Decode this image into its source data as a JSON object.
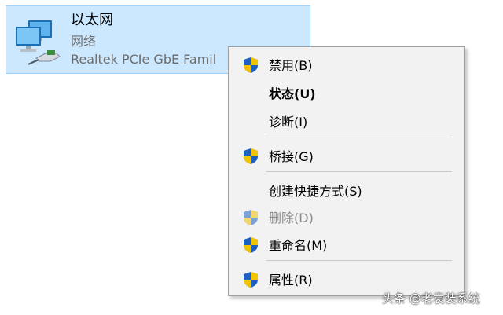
{
  "adapter": {
    "name": "以太网",
    "status": "网络",
    "device": "Realtek PCIe GbE Famil",
    "icon": "network-adapter-icon"
  },
  "context_menu": {
    "items": [
      {
        "label": "禁用(B)",
        "icon": "uac-shield-icon",
        "bold": false,
        "disabled": false
      },
      {
        "label": "状态(U)",
        "icon": "",
        "bold": true,
        "disabled": false
      },
      {
        "label": "诊断(I)",
        "icon": "",
        "bold": false,
        "disabled": false
      },
      {
        "label": "桥接(G)",
        "icon": "uac-shield-icon",
        "bold": false,
        "disabled": false
      },
      {
        "label": "创建快捷方式(S)",
        "icon": "",
        "bold": false,
        "disabled": false
      },
      {
        "label": "删除(D)",
        "icon": "uac-shield-icon",
        "bold": false,
        "disabled": true
      },
      {
        "label": "重命名(M)",
        "icon": "uac-shield-icon",
        "bold": false,
        "disabled": false
      },
      {
        "label": "属性(R)",
        "icon": "uac-shield-icon",
        "bold": false,
        "disabled": false
      }
    ]
  },
  "watermark": "头条 @老袁装系统",
  "colors": {
    "selection_bg": "#cce8ff",
    "selection_border": "#99d1ff",
    "menu_bg": "#f2f2f2",
    "shield_blue": "#1f5fbf",
    "shield_yellow": "#f2c300"
  }
}
